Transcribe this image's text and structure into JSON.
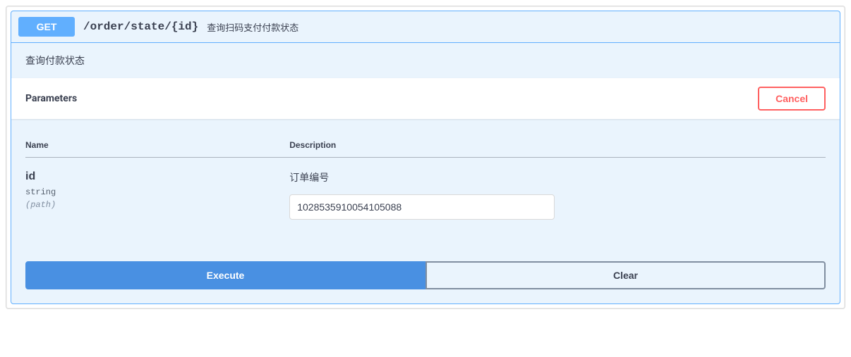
{
  "operation": {
    "method": "GET",
    "path": "/order/state/{id}",
    "summary": "查询扫码支付付款状态",
    "description": "查询付款状态"
  },
  "parametersSection": {
    "title": "Parameters",
    "cancelLabel": "Cancel",
    "headers": {
      "name": "Name",
      "description": "Description"
    },
    "params": [
      {
        "name": "id",
        "type": "string",
        "in": "(path)",
        "description": "订单编号",
        "value": "1028535910054105088"
      }
    ]
  },
  "actions": {
    "execute": "Execute",
    "clear": "Clear"
  }
}
